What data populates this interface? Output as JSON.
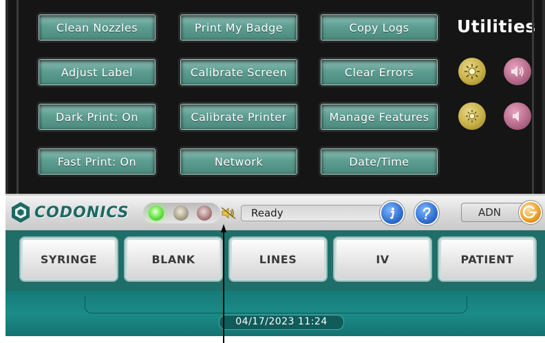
{
  "utilities": {
    "title": "Utilities",
    "buttons": [
      {
        "label": "Clean Nozzles"
      },
      {
        "label": "Print My Badge"
      },
      {
        "label": "Copy Logs"
      },
      {
        "label": "Adjust Label"
      },
      {
        "label": "Calibrate Screen"
      },
      {
        "label": "Clear Errors"
      },
      {
        "label": "Dark Print: On"
      },
      {
        "label": "Calibrate Printer"
      },
      {
        "label": "Manage Features"
      },
      {
        "label": "Fast Print: On"
      },
      {
        "label": "Network"
      },
      {
        "label": "Date/Time"
      }
    ],
    "icons": {
      "brightness_up": "sun-icon",
      "volume_up": "speaker-icon",
      "brightness_down": "sun-icon",
      "volume_down": "speaker-icon"
    }
  },
  "statusbar": {
    "logo": "CODONICS",
    "status_text": "Ready",
    "user": "ADN",
    "colors": {
      "led_active": "#7cf05a",
      "brand": "#1b6a64",
      "info": "#2f6fd0",
      "power": "#f0a32b"
    }
  },
  "tabs": [
    {
      "label": "SYRINGE"
    },
    {
      "label": "BLANK"
    },
    {
      "label": "LINES"
    },
    {
      "label": "IV"
    },
    {
      "label": "PATIENT"
    }
  ],
  "footer": {
    "datetime": "04/17/2023 11:24"
  },
  "colors": {
    "panel_bg": "#151515",
    "button_teal": "#5e9e92",
    "footer_teal": "#1b8c88"
  }
}
